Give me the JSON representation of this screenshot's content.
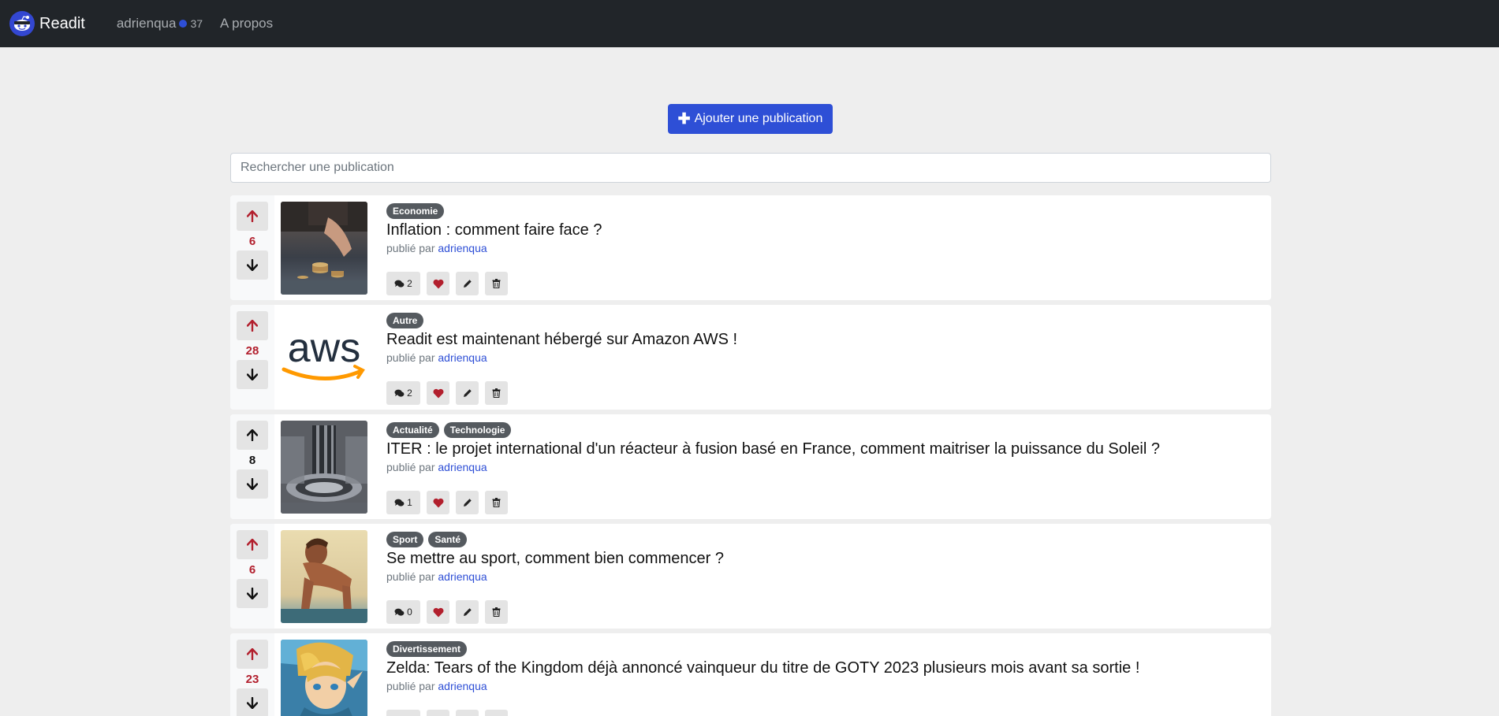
{
  "nav": {
    "brand": "Readit",
    "username": "adrienqua",
    "karma": "37",
    "about": "A propos"
  },
  "add_button": "Ajouter une publication",
  "search": {
    "placeholder": "Rechercher une publication",
    "value": ""
  },
  "byline_prefix": "publié par",
  "colors": {
    "accent": "#2e4fd6",
    "upvoted": "#b21f2d",
    "navbar": "#212529",
    "like": "#b21f2d"
  },
  "posts": [
    {
      "score": "6",
      "vote": "up",
      "tags": [
        "Economie"
      ],
      "title": "Inflation : comment faire face ?",
      "author": "adrienqua",
      "comments": "2",
      "image": "coins-photo"
    },
    {
      "score": "28",
      "vote": "up",
      "tags": [
        "Autre"
      ],
      "title": "Readit est maintenant hébergé sur Amazon AWS !",
      "author": "adrienqua",
      "comments": "2",
      "image": "aws-logo",
      "image_text": "aws"
    },
    {
      "score": "8",
      "vote": "none",
      "tags": [
        "Actualité",
        "Technologie"
      ],
      "title": "ITER : le projet international d'un réacteur à fusion basé en France, comment maitriser la puissance du Soleil ?",
      "author": "adrienqua",
      "comments": "1",
      "image": "reactor-photo"
    },
    {
      "score": "6",
      "vote": "up",
      "tags": [
        "Sport",
        "Santé"
      ],
      "title": "Se mettre au sport, comment bien commencer ?",
      "author": "adrienqua",
      "comments": "0",
      "image": "athlete-photo"
    },
    {
      "score": "23",
      "vote": "up",
      "tags": [
        "Divertissement"
      ],
      "title": "Zelda: Tears of the Kingdom déjà annoncé vainqueur du titre de GOTY 2023 plusieurs mois avant sa sortie !",
      "author": "adrienqua",
      "comments": "",
      "image": "zelda-art"
    }
  ]
}
